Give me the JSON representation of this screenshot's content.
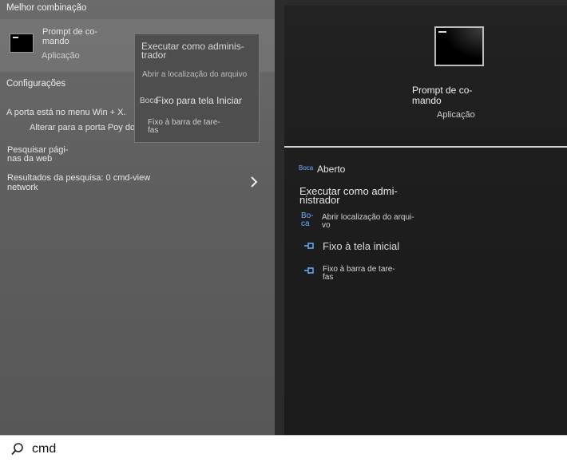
{
  "left": {
    "best_match_header": "Melhor combinação",
    "best_match": {
      "title_line1": "Prompt de co-",
      "title_line2": "mando",
      "subtitle": "Aplicação"
    },
    "settings_header": "Configurações",
    "settings_item1": "A porta está no menu Win + X.",
    "settings_item2": "Alterar para a porta Poy do Windows",
    "web_line1": "Pesquisar pági-",
    "web_line2": "nas da web",
    "results_line1": "Resultados da pesquisa: 0 cmd-view",
    "results_line2": "network"
  },
  "context_menu": {
    "run_admin_line1": "Executar como adminis-",
    "run_admin_line2": "trador",
    "open_location": "Abrir a localização do arquivo",
    "pin_start_prefix": "Boca",
    "pin_start": "Fixo para tela Iniciar",
    "pin_taskbar_line1": "Fixo à barra de tare-",
    "pin_taskbar_line2": "fas"
  },
  "preview": {
    "title_line1": "Prompt de co-",
    "title_line2": "mando",
    "subtitle": "Aplicação",
    "actions": {
      "open_prefix": "Boca",
      "open": "Aberto",
      "run_admin_line1": "Executar como admi-",
      "run_admin_line2": "nistrador",
      "open_location_prefix_line1": "Bo-",
      "open_location_prefix_line2": "ca",
      "open_location_line1": "Abrir localização do arqui-",
      "open_location_line2": "vo",
      "pin_start": "Fixo à tela inicial",
      "pin_taskbar_line1": "Fixo à barra de tare-",
      "pin_taskbar_line2": "fas"
    }
  },
  "search": {
    "value": "cmd"
  },
  "icons": {
    "search": "magnifier-icon",
    "chevron": "chevron-right-icon",
    "pin": "pin-icon",
    "app": "command-prompt-icon"
  },
  "colors": {
    "accent": "#6ab0ff"
  }
}
